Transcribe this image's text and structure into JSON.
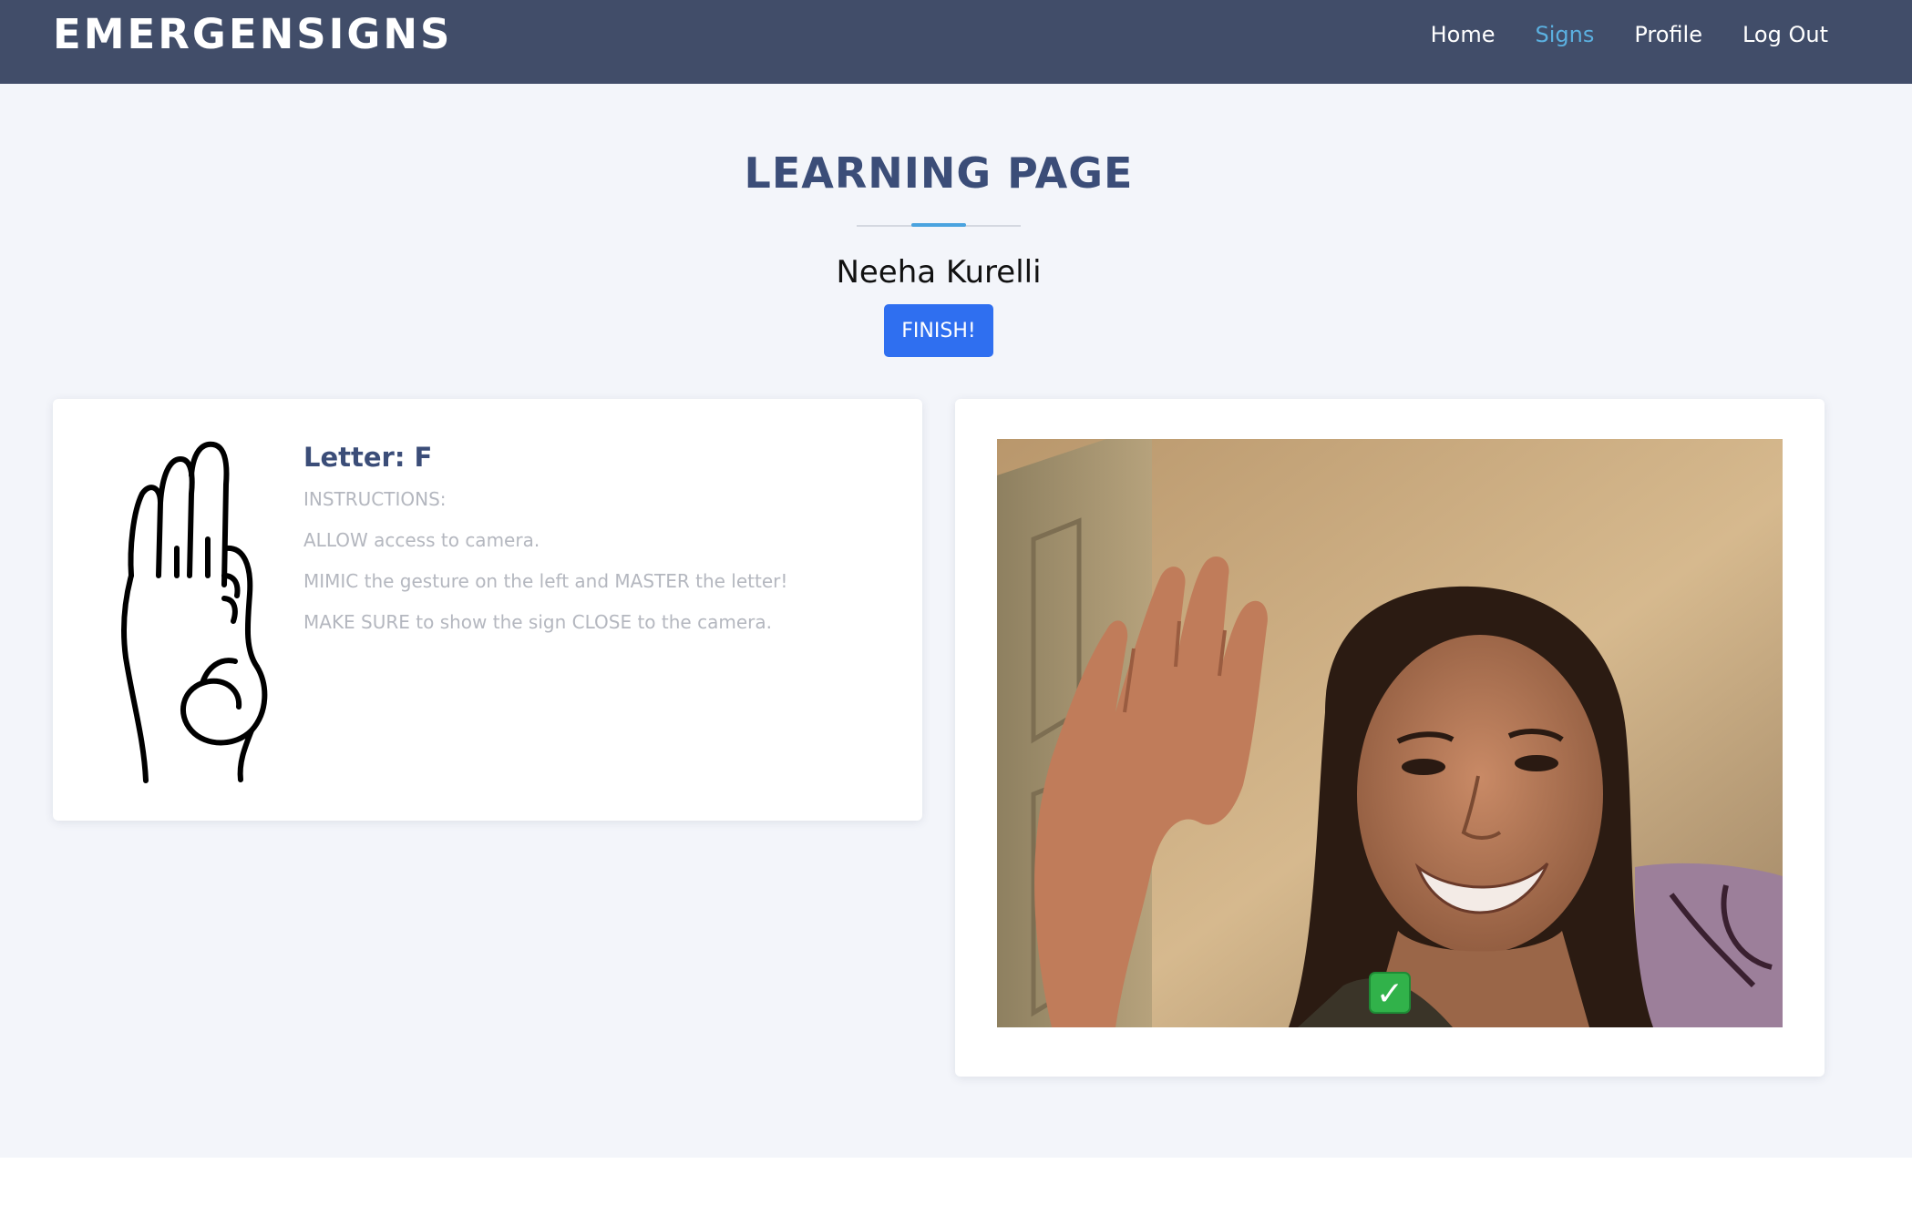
{
  "navbar": {
    "brand": "EMERGENSIGNS",
    "links": [
      {
        "label": "Home",
        "active": false
      },
      {
        "label": "Signs",
        "active": true
      },
      {
        "label": "Profile",
        "active": false
      },
      {
        "label": "Log Out",
        "active": false
      }
    ]
  },
  "main": {
    "title": "LEARNING PAGE",
    "user_name": "Neeha Kurelli",
    "finish_label": "FINISH!"
  },
  "lesson": {
    "letter_title": "Letter: F",
    "hand_icon": "asl-letter-f-hand-icon",
    "instructions": [
      "INSTRUCTIONS:",
      "ALLOW access to camera.",
      "MIMIC the gesture on the left and MASTER the letter!",
      "MAKE SURE to show the sign CLOSE to the camera."
    ]
  },
  "camera": {
    "status_icon": "check-mark-icon",
    "status_glyph": "✓"
  },
  "colors": {
    "navbar_bg": "#414d69",
    "active_link": "#5bb0e0",
    "title": "#3b4d78",
    "accent": "#4aa3df",
    "button": "#2f6ff0",
    "page_bg": "#f3f5fa",
    "success": "#31b24a"
  }
}
